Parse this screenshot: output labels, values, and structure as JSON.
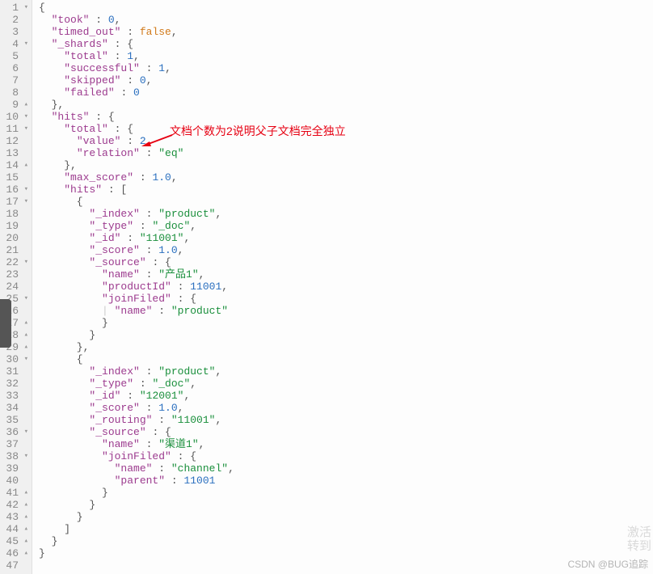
{
  "annotation": "文档个数为2说明父子文档完全独立",
  "watermark": "CSDN @BUG追踪",
  "watermark2_l1": "激活",
  "watermark2_l2": "转到",
  "lines": [
    {
      "n": 1,
      "f": "▾",
      "content": [
        [
          "p",
          "{"
        ]
      ]
    },
    {
      "n": 2,
      "content": [
        [
          "p",
          "  "
        ],
        [
          "k",
          "\"took\""
        ],
        [
          "p",
          " : "
        ],
        [
          "n",
          "0"
        ],
        [
          "p",
          ","
        ]
      ]
    },
    {
      "n": 3,
      "content": [
        [
          "p",
          "  "
        ],
        [
          "k",
          "\"timed_out\""
        ],
        [
          "p",
          " : "
        ],
        [
          "b",
          "false"
        ],
        [
          "p",
          ","
        ]
      ]
    },
    {
      "n": 4,
      "f": "▾",
      "content": [
        [
          "p",
          "  "
        ],
        [
          "k",
          "\"_shards\""
        ],
        [
          "p",
          " : {"
        ]
      ]
    },
    {
      "n": 5,
      "content": [
        [
          "p",
          "    "
        ],
        [
          "k",
          "\"total\""
        ],
        [
          "p",
          " : "
        ],
        [
          "n",
          "1"
        ],
        [
          "p",
          ","
        ]
      ]
    },
    {
      "n": 6,
      "content": [
        [
          "p",
          "    "
        ],
        [
          "k",
          "\"successful\""
        ],
        [
          "p",
          " : "
        ],
        [
          "n",
          "1"
        ],
        [
          "p",
          ","
        ]
      ]
    },
    {
      "n": 7,
      "content": [
        [
          "p",
          "    "
        ],
        [
          "k",
          "\"skipped\""
        ],
        [
          "p",
          " : "
        ],
        [
          "n",
          "0"
        ],
        [
          "p",
          ","
        ]
      ]
    },
    {
      "n": 8,
      "content": [
        [
          "p",
          "    "
        ],
        [
          "k",
          "\"failed\""
        ],
        [
          "p",
          " : "
        ],
        [
          "n",
          "0"
        ]
      ]
    },
    {
      "n": 9,
      "f": "▴",
      "content": [
        [
          "p",
          "  },"
        ]
      ]
    },
    {
      "n": 10,
      "f": "▾",
      "content": [
        [
          "p",
          "  "
        ],
        [
          "k",
          "\"hits\""
        ],
        [
          "p",
          " : {"
        ]
      ]
    },
    {
      "n": 11,
      "f": "▾",
      "content": [
        [
          "p",
          "    "
        ],
        [
          "k",
          "\"total\""
        ],
        [
          "p",
          " : {"
        ]
      ]
    },
    {
      "n": 12,
      "content": [
        [
          "p",
          "      "
        ],
        [
          "k",
          "\"value\""
        ],
        [
          "p",
          " : "
        ],
        [
          "n",
          "2"
        ],
        [
          "p",
          ","
        ]
      ]
    },
    {
      "n": 13,
      "content": [
        [
          "p",
          "      "
        ],
        [
          "k",
          "\"relation\""
        ],
        [
          "p",
          " : "
        ],
        [
          "s",
          "\"eq\""
        ]
      ]
    },
    {
      "n": 14,
      "f": "▴",
      "content": [
        [
          "p",
          "    },"
        ]
      ]
    },
    {
      "n": 15,
      "content": [
        [
          "p",
          "    "
        ],
        [
          "k",
          "\"max_score\""
        ],
        [
          "p",
          " : "
        ],
        [
          "n",
          "1.0"
        ],
        [
          "p",
          ","
        ]
      ]
    },
    {
      "n": 16,
      "f": "▾",
      "content": [
        [
          "p",
          "    "
        ],
        [
          "k",
          "\"hits\""
        ],
        [
          "p",
          " : ["
        ]
      ]
    },
    {
      "n": 17,
      "f": "▾",
      "content": [
        [
          "p",
          "      {"
        ]
      ]
    },
    {
      "n": 18,
      "content": [
        [
          "p",
          "        "
        ],
        [
          "k",
          "\"_index\""
        ],
        [
          "p",
          " : "
        ],
        [
          "s",
          "\"product\""
        ],
        [
          "p",
          ","
        ]
      ]
    },
    {
      "n": 19,
      "content": [
        [
          "p",
          "        "
        ],
        [
          "k",
          "\"_type\""
        ],
        [
          "p",
          " : "
        ],
        [
          "s",
          "\"_doc\""
        ],
        [
          "p",
          ","
        ]
      ]
    },
    {
      "n": 20,
      "content": [
        [
          "p",
          "        "
        ],
        [
          "k",
          "\"_id\""
        ],
        [
          "p",
          " : "
        ],
        [
          "s",
          "\"11001\""
        ],
        [
          "p",
          ","
        ]
      ]
    },
    {
      "n": 21,
      "content": [
        [
          "p",
          "        "
        ],
        [
          "k",
          "\"_score\""
        ],
        [
          "p",
          " : "
        ],
        [
          "n",
          "1.0"
        ],
        [
          "p",
          ","
        ]
      ]
    },
    {
      "n": 22,
      "f": "▾",
      "content": [
        [
          "p",
          "        "
        ],
        [
          "k",
          "\"_source\""
        ],
        [
          "p",
          " : {"
        ]
      ]
    },
    {
      "n": 23,
      "content": [
        [
          "p",
          "          "
        ],
        [
          "k",
          "\"name\""
        ],
        [
          "p",
          " : "
        ],
        [
          "s",
          "\"产品1\""
        ],
        [
          "p",
          ","
        ]
      ]
    },
    {
      "n": 24,
      "content": [
        [
          "p",
          "          "
        ],
        [
          "k",
          "\"productId\""
        ],
        [
          "p",
          " : "
        ],
        [
          "n",
          "11001"
        ],
        [
          "p",
          ","
        ]
      ]
    },
    {
      "n": 25,
      "f": "▾",
      "content": [
        [
          "p",
          "          "
        ],
        [
          "k",
          "\"joinFiled\""
        ],
        [
          "p",
          " : {"
        ]
      ]
    },
    {
      "n": 26,
      "content": [
        [
          "p",
          "          "
        ],
        [
          "guide",
          "| "
        ],
        [
          "k",
          "\"name\""
        ],
        [
          "p",
          " : "
        ],
        [
          "s",
          "\"product\""
        ]
      ]
    },
    {
      "n": 27,
      "f": "▴",
      "content": [
        [
          "p",
          "          }"
        ]
      ]
    },
    {
      "n": 28,
      "f": "▴",
      "content": [
        [
          "p",
          "        }"
        ]
      ]
    },
    {
      "n": 29,
      "f": "▴",
      "content": [
        [
          "p",
          "      },"
        ]
      ]
    },
    {
      "n": 30,
      "f": "▾",
      "content": [
        [
          "p",
          "      {"
        ]
      ]
    },
    {
      "n": 31,
      "content": [
        [
          "p",
          "        "
        ],
        [
          "k",
          "\"_index\""
        ],
        [
          "p",
          " : "
        ],
        [
          "s",
          "\"product\""
        ],
        [
          "p",
          ","
        ]
      ]
    },
    {
      "n": 32,
      "content": [
        [
          "p",
          "        "
        ],
        [
          "k",
          "\"_type\""
        ],
        [
          "p",
          " : "
        ],
        [
          "s",
          "\"_doc\""
        ],
        [
          "p",
          ","
        ]
      ]
    },
    {
      "n": 33,
      "content": [
        [
          "p",
          "        "
        ],
        [
          "k",
          "\"_id\""
        ],
        [
          "p",
          " : "
        ],
        [
          "s",
          "\"12001\""
        ],
        [
          "p",
          ","
        ]
      ]
    },
    {
      "n": 34,
      "content": [
        [
          "p",
          "        "
        ],
        [
          "k",
          "\"_score\""
        ],
        [
          "p",
          " : "
        ],
        [
          "n",
          "1.0"
        ],
        [
          "p",
          ","
        ]
      ]
    },
    {
      "n": 35,
      "content": [
        [
          "p",
          "        "
        ],
        [
          "k",
          "\"_routing\""
        ],
        [
          "p",
          " : "
        ],
        [
          "s",
          "\"11001\""
        ],
        [
          "p",
          ","
        ]
      ]
    },
    {
      "n": 36,
      "f": "▾",
      "content": [
        [
          "p",
          "        "
        ],
        [
          "k",
          "\"_source\""
        ],
        [
          "p",
          " : {"
        ]
      ]
    },
    {
      "n": 37,
      "content": [
        [
          "p",
          "          "
        ],
        [
          "k",
          "\"name\""
        ],
        [
          "p",
          " : "
        ],
        [
          "s",
          "\"渠道1\""
        ],
        [
          "p",
          ","
        ]
      ]
    },
    {
      "n": 38,
      "f": "▾",
      "content": [
        [
          "p",
          "          "
        ],
        [
          "k",
          "\"joinFiled\""
        ],
        [
          "p",
          " : {"
        ]
      ]
    },
    {
      "n": 39,
      "content": [
        [
          "p",
          "            "
        ],
        [
          "k",
          "\"name\""
        ],
        [
          "p",
          " : "
        ],
        [
          "s",
          "\"channel\""
        ],
        [
          "p",
          ","
        ]
      ]
    },
    {
      "n": 40,
      "content": [
        [
          "p",
          "            "
        ],
        [
          "k",
          "\"parent\""
        ],
        [
          "p",
          " : "
        ],
        [
          "n",
          "11001"
        ]
      ]
    },
    {
      "n": 41,
      "f": "▴",
      "content": [
        [
          "p",
          "          }"
        ]
      ]
    },
    {
      "n": 42,
      "f": "▴",
      "content": [
        [
          "p",
          "        }"
        ]
      ]
    },
    {
      "n": 43,
      "f": "▴",
      "content": [
        [
          "p",
          "      }"
        ]
      ]
    },
    {
      "n": 44,
      "f": "▴",
      "content": [
        [
          "p",
          "    ]"
        ]
      ]
    },
    {
      "n": 45,
      "f": "▴",
      "content": [
        [
          "p",
          "  }"
        ]
      ]
    },
    {
      "n": 46,
      "f": "▴",
      "content": [
        [
          "p",
          "}"
        ]
      ]
    },
    {
      "n": 47,
      "content": []
    }
  ]
}
